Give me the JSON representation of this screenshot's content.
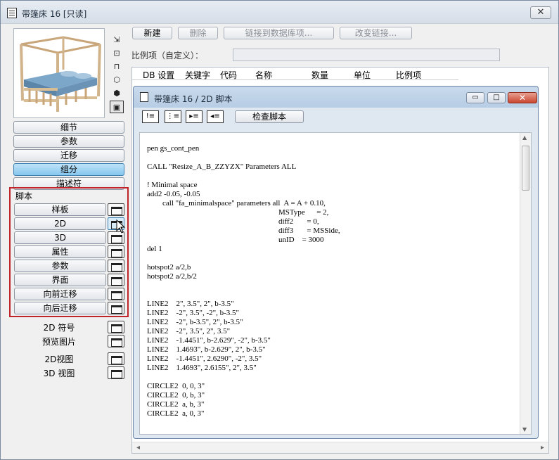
{
  "window": {
    "title": "带篷床 16 [只读]",
    "close": "✕"
  },
  "view_tools": [
    "⇲",
    "⊡",
    "⊓",
    "⬡",
    "⬢",
    "▣"
  ],
  "nav": [
    "细节",
    "参数",
    "迁移",
    "组分",
    "描述符"
  ],
  "nav_active_index": 3,
  "script_group": {
    "label": "脚本",
    "items": [
      "样板",
      "2D",
      "3D",
      "属性",
      "参数",
      "界面",
      "向前迁移",
      "向后迁移"
    ]
  },
  "extra_items": [
    "2D 符号",
    "预览图片",
    "2D视图",
    "3D 视图"
  ],
  "toolbar": {
    "new": "新建",
    "delete": "删除",
    "link_db": "链接到数据库项...",
    "change_link": "改变链接..."
  },
  "prop_label": "比例项（自定义）：",
  "table_headers": [
    "DB 设置",
    "关键字",
    "代码",
    "名称",
    "数量",
    "单位",
    "比例项"
  ],
  "sub_window": {
    "title": "带篷床 16 / 2D 脚本",
    "minimize": "▭",
    "maximize": "□",
    "close": "✕",
    "icons": [
      "!≡",
      "⋮≡",
      "▸≡",
      "◂≡"
    ],
    "check_script": "检查脚本"
  },
  "code_lines": [
    "pen gs_cont_pen",
    "",
    "CALL \"Resize_A_B_ZZYZX\" Parameters ALL",
    "",
    "! Minimal space",
    "add2 -0.05, -0.05",
    "        call \"fa_minimalspace\" parameters all  A = A + 0.10,",
    "                                                                    MSType      = 2,",
    "                                                                    diff2       = 0,",
    "                                                                    diff3       = MSSide,",
    "                                                                    unID    = 3000",
    "del 1",
    "",
    "hotspot2 a/2,b",
    "hotspot2 a/2,b/2",
    "",
    "",
    "LINE2    2\", 3.5\", 2\", b-3.5\"",
    "LINE2    -2\", 3.5\", -2\", b-3.5\"",
    "LINE2    -2\", b-3.5\", 2\", b-3.5\"",
    "LINE2    -2\", 3.5\", 2\", 3.5\"",
    "LINE2    -1.4451\", b-2.629\", -2\", b-3.5\"",
    "LINE2    1.4693\", b-2.629\", 2\", b-3.5\"",
    "LINE2    -1.4451\", 2.6290\", -2\", 3.5\"",
    "LINE2    1.4693\", 2.6155\", 2\", 3.5\"",
    "",
    "CIRCLE2  0, 0, 3\"",
    "CIRCLE2  0, b, 3\"",
    "CIRCLE2  a, b, 3\"",
    "CIRCLE2  a, 0, 3\""
  ],
  "scroll_arrows": {
    "left": "◂",
    "right": "▸",
    "up": "▲",
    "down": "▼"
  }
}
